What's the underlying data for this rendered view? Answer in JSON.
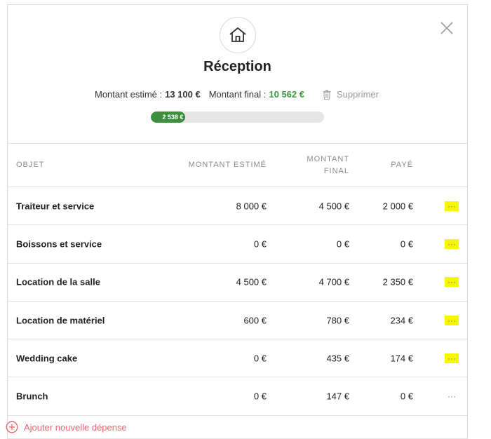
{
  "header": {
    "title": "Réception",
    "icon": "house-icon",
    "estimated_label": "Montant estimé :",
    "estimated_value": "13 100 €",
    "final_label": "Montant final :",
    "final_value": "10 562 €",
    "delete_label": "Supprimer"
  },
  "progress": {
    "label": "2 538 €",
    "fraction": 0.2,
    "color": "#3d8f3d"
  },
  "table": {
    "headers": {
      "objet": "OBJET",
      "estime": "MONTANT ESTIMÉ",
      "final_line1": "MONTANT",
      "final_line2": "FINAL",
      "paye": "PAYÉ"
    },
    "rows": [
      {
        "name": "Traiteur et service",
        "estime": "8 000 €",
        "final": "4 500 €",
        "paye": "2 000 €",
        "more": "···"
      },
      {
        "name": "Boissons et service",
        "estime": "0 €",
        "final": "0 €",
        "paye": "0 €",
        "more": "···"
      },
      {
        "name": "Location de la salle",
        "estime": "4 500 €",
        "final": "4 700 €",
        "paye": "2 350 €",
        "more": "···"
      },
      {
        "name": "Location de matériel",
        "estime": "600 €",
        "final": "780 €",
        "paye": "234 €",
        "more": "···"
      },
      {
        "name": "Wedding cake",
        "estime": "0 €",
        "final": "435 €",
        "paye": "174 €",
        "more": "···"
      },
      {
        "name": "Brunch",
        "estime": "0 €",
        "final": "147 €",
        "paye": "0 €",
        "more": "···"
      }
    ]
  },
  "footer": {
    "add_label": "Ajouter nouvelle dépense"
  },
  "colors": {
    "accent_green": "#3c9a3c",
    "highlight": "#f6f600",
    "add_red": "#e8676b"
  }
}
